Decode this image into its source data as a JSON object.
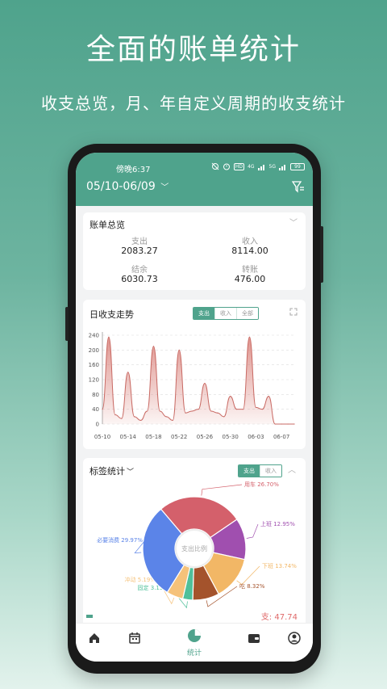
{
  "promo": {
    "title": "全面的账单统计",
    "subtitle": "收支总览，月、年自定义周期的收支统计"
  },
  "status_bar": {
    "time": "傍晚6:37",
    "network_badge": "HD",
    "network_type": "4G",
    "network_type2": "5G",
    "battery": "99"
  },
  "header": {
    "date_range": "05/10-06/09",
    "chevron": "chevron-down-icon",
    "filter": "filter-icon"
  },
  "overview": {
    "title": "账单总览",
    "items": [
      {
        "label": "支出",
        "value": "2083.27"
      },
      {
        "label": "收入",
        "value": "8114.00"
      },
      {
        "label": "结余",
        "value": "6030.73"
      },
      {
        "label": "转账",
        "value": "476.00"
      }
    ]
  },
  "trend": {
    "title": "日收支走势",
    "tabs": [
      "支出",
      "收入",
      "全部"
    ],
    "active_tab": "支出"
  },
  "chart_data": {
    "type": "area",
    "title": "日收支走势",
    "xlabel": "",
    "ylabel": "",
    "ylim": [
      0,
      240
    ],
    "yticks": [
      0,
      40,
      80,
      120,
      160,
      200,
      240
    ],
    "xtick_labels": [
      "05-10",
      "05-14",
      "05-18",
      "05-22",
      "05-26",
      "05-30",
      "06-03",
      "06-07"
    ],
    "x": [
      "05-10",
      "05-11",
      "05-12",
      "05-13",
      "05-14",
      "05-15",
      "05-16",
      "05-17",
      "05-18",
      "05-19",
      "05-20",
      "05-21",
      "05-22",
      "05-23",
      "05-24",
      "05-25",
      "05-26",
      "05-27",
      "05-28",
      "05-29",
      "05-30",
      "05-31",
      "06-01",
      "06-02",
      "06-03",
      "06-04",
      "06-05",
      "06-06",
      "06-07",
      "06-08",
      "06-09"
    ],
    "values": [
      40,
      235,
      25,
      15,
      140,
      20,
      10,
      35,
      210,
      35,
      20,
      10,
      200,
      30,
      35,
      40,
      110,
      35,
      30,
      20,
      75,
      40,
      40,
      235,
      45,
      40,
      75,
      0,
      0,
      0,
      0
    ],
    "grid": true,
    "color": "#d9817a"
  },
  "tags": {
    "title": "标签统计",
    "tabs": [
      "支出",
      "收入"
    ],
    "active_tab": "支出",
    "center_label": "支出比例",
    "slices": [
      {
        "name": "用车",
        "percent": "26.70%",
        "value": 26.7,
        "color": "#d4606b"
      },
      {
        "name": "上班",
        "percent": "12.95%",
        "value": 12.95,
        "color": "#a04faf"
      },
      {
        "name": "下班",
        "percent": "13.74%",
        "value": 13.74,
        "color": "#f2b766"
      },
      {
        "name": "吃",
        "percent": "8.32%",
        "value": 8.32,
        "color": "#a4532c"
      },
      {
        "name": "固定",
        "percent": "3.13%",
        "value": 3.13,
        "color": "#4fc09a"
      },
      {
        "name": "冲动",
        "percent": "5.19%",
        "value": 5.19,
        "color": "#f5c27a"
      },
      {
        "name": "必要消费",
        "percent": "29.97%",
        "value": 29.97,
        "color": "#5b84e8"
      }
    ],
    "footer_text": "支: 47.74"
  },
  "nav": {
    "items": [
      {
        "icon": "home-icon",
        "label": ""
      },
      {
        "icon": "calendar-icon",
        "label": ""
      },
      {
        "icon": "pie-chart-icon",
        "label": "统计"
      },
      {
        "icon": "wallet-icon",
        "label": ""
      },
      {
        "icon": "user-icon",
        "label": ""
      }
    ]
  },
  "colors": {
    "brand": "#4fa38c",
    "chart": "#d9817a"
  }
}
